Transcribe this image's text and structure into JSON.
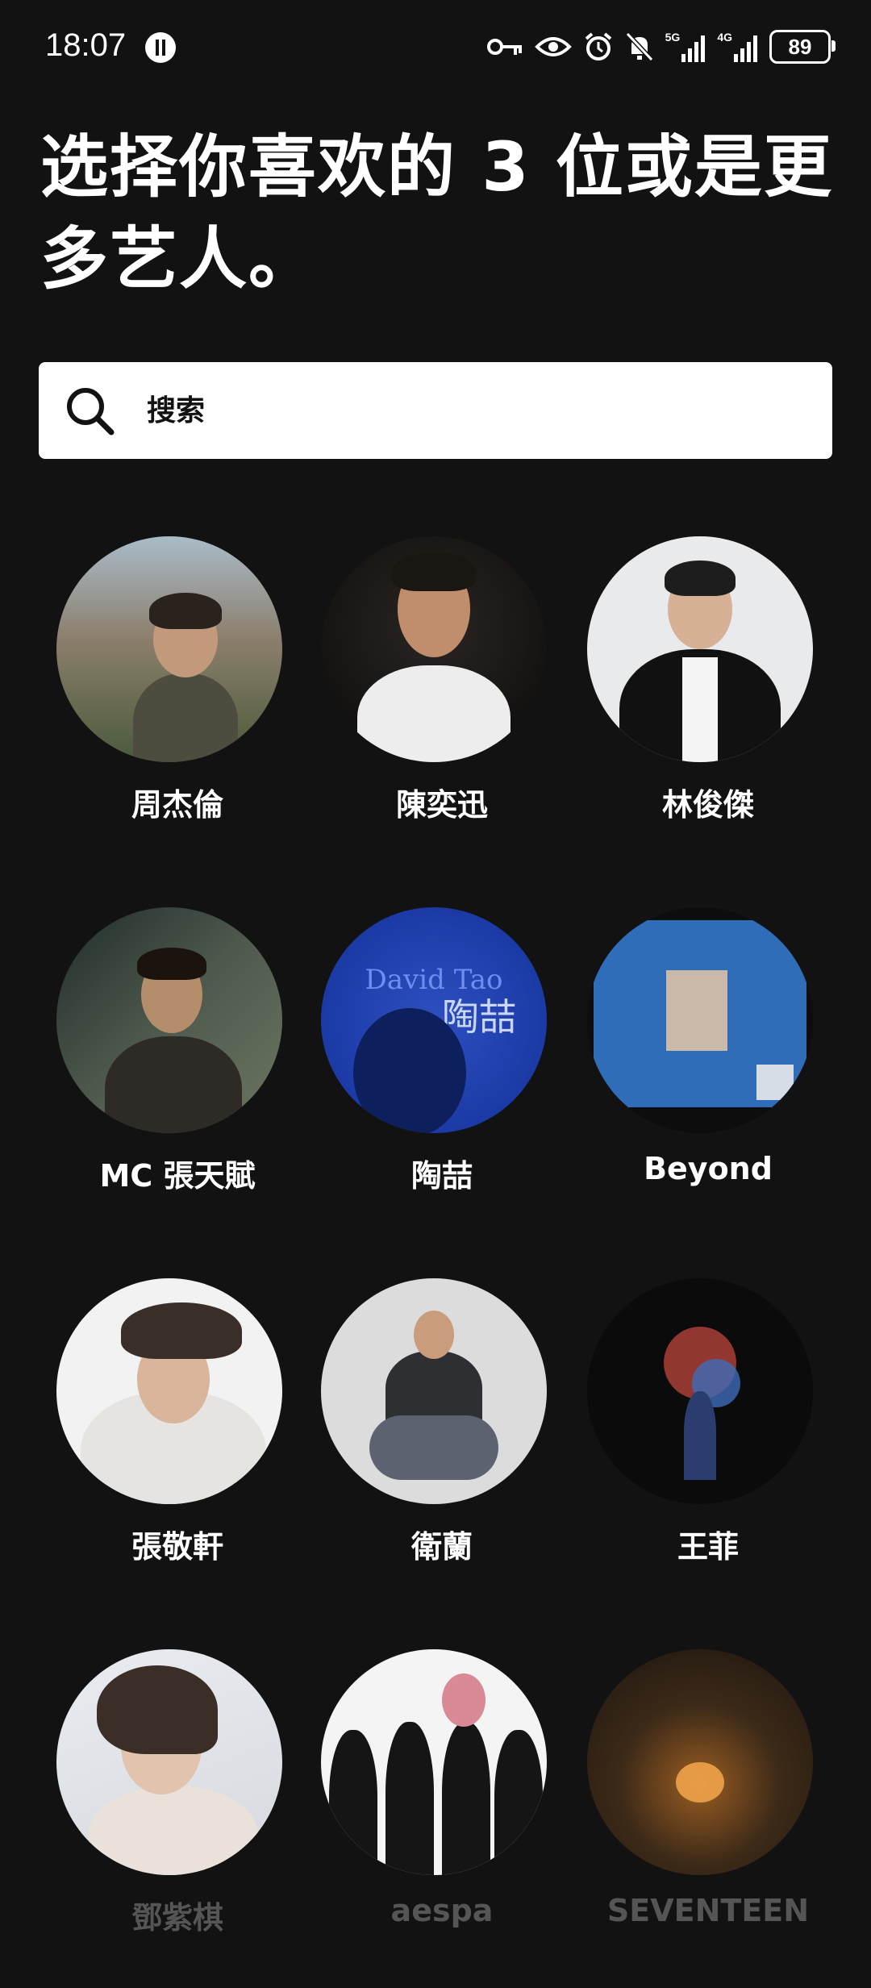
{
  "status_bar": {
    "time": "18:07",
    "icons": [
      "vpn-key-icon",
      "eye-icon",
      "alarm-icon",
      "mute-bell-icon",
      "signal-5g-icon",
      "signal-4g-icon"
    ],
    "net_5g": "5G",
    "net_4g": "4G",
    "battery": "89"
  },
  "page": {
    "heading": "选择你喜欢的 3 位或是更多艺人。"
  },
  "search": {
    "placeholder": "搜索"
  },
  "artists": [
    {
      "name": "周杰倫"
    },
    {
      "name": "陳奕迅"
    },
    {
      "name": "林俊傑"
    },
    {
      "name": "MC 張天賦"
    },
    {
      "name": "陶喆"
    },
    {
      "name": "Beyond"
    },
    {
      "name": "張敬軒"
    },
    {
      "name": "衛蘭"
    },
    {
      "name": "王菲"
    },
    {
      "name": "鄧紫棋"
    },
    {
      "name": "aespa"
    },
    {
      "name": "SEVENTEEN"
    }
  ],
  "colors": {
    "background": "#121212",
    "text": "#ffffff",
    "search_bg": "#ffffff"
  }
}
